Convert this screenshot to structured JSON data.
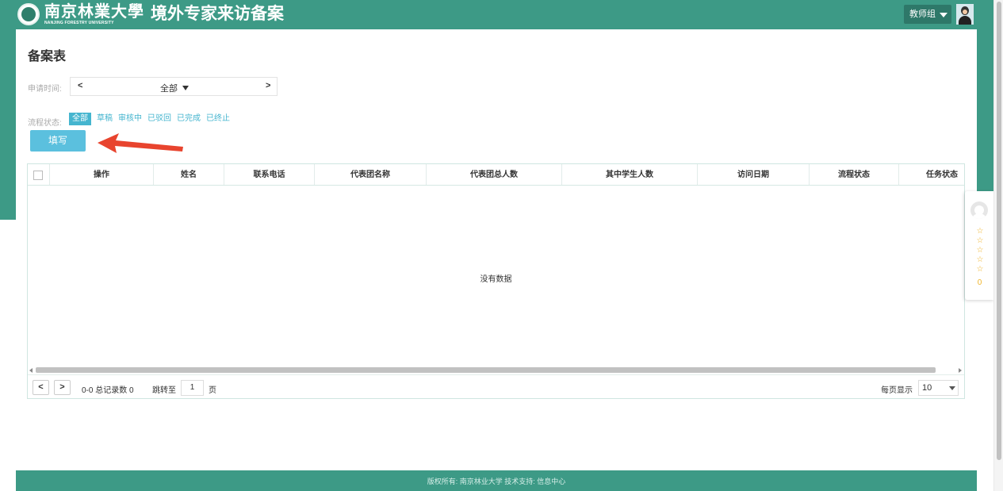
{
  "header": {
    "logo_cn": "南京林業大學",
    "logo_en": "NANJING FORESTRY UNIVERSITY",
    "app_title": "境外专家来访备案",
    "user_group": "教师组"
  },
  "page": {
    "heading": "备案表"
  },
  "filters": {
    "date_label": "申请时间:",
    "date_prev": "<",
    "date_value": "全部",
    "date_next": ">",
    "status_label": "流程状态:",
    "status_tabs": [
      "全部",
      "草稿",
      "审核中",
      "已驳回",
      "已完成",
      "已终止"
    ],
    "active_status": "全部"
  },
  "actions": {
    "fill_label": "填写"
  },
  "table": {
    "columns": [
      "操作",
      "姓名",
      "联系电话",
      "代表团名称",
      "代表团总人数",
      "其中学生人数",
      "访问日期",
      "流程状态",
      "任务状态"
    ],
    "rows": [],
    "empty_text": "没有数据"
  },
  "pagination": {
    "prev": "<",
    "next": ">",
    "range_text": "0-0 总记录数 0",
    "jump_label": "跳转至",
    "page_value": "1",
    "page_unit": "页",
    "per_page_label": "每页显示",
    "per_page_value": "10"
  },
  "footer": {
    "text": "版权所有: 南京林业大学   技术支持: 信息中心"
  },
  "rating_widget": {
    "stars": [
      "☆",
      "☆",
      "☆",
      "☆",
      "☆"
    ],
    "count": "0"
  },
  "colors": {
    "brand_teal": "#3d9a86",
    "accent_blue": "#5bc0de",
    "arrow_red": "#e8442e",
    "star_gold": "#f0b429"
  }
}
